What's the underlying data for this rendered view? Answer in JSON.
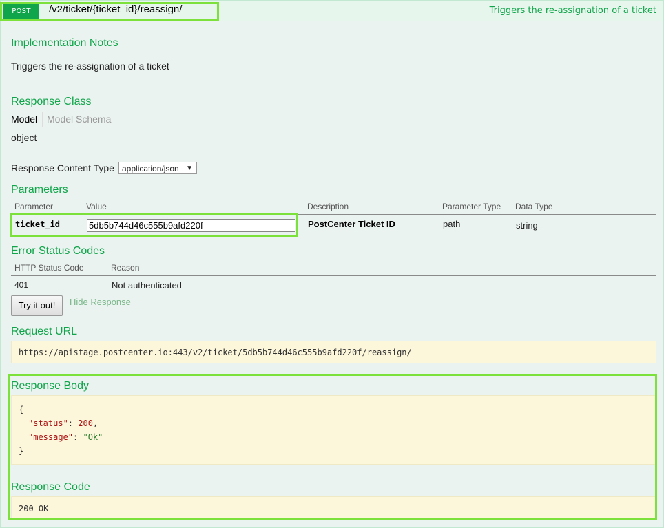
{
  "operation": {
    "method": "POST",
    "path": "/v2/ticket/{ticket_id}/reassign/",
    "summary": "Triggers the re-assignation of a ticket"
  },
  "implementation_notes": {
    "heading": "Implementation Notes",
    "text": "Triggers the re-assignation of a ticket"
  },
  "response_class": {
    "heading": "Response Class",
    "tab_model": "Model",
    "tab_schema": "Model Schema",
    "value": "object"
  },
  "response_content_type": {
    "label": "Response Content Type",
    "selected": "application/json"
  },
  "parameters": {
    "heading": "Parameters",
    "columns": [
      "Parameter",
      "Value",
      "Description",
      "Parameter Type",
      "Data Type"
    ],
    "rows": [
      {
        "name": "ticket_id",
        "value": "5db5b744d46c555b9afd220f",
        "description": "PostCenter Ticket ID",
        "param_type": "path",
        "data_type": "string"
      }
    ]
  },
  "error_status_codes": {
    "heading": "Error Status Codes",
    "columns": [
      "HTTP Status Code",
      "Reason"
    ],
    "rows": [
      {
        "code": "401",
        "reason": "Not authenticated"
      }
    ]
  },
  "actions": {
    "try_label": "Try it out!",
    "hide_label": "Hide Response"
  },
  "request_url": {
    "heading": "Request URL",
    "url": "https://apistage.postcenter.io:443/v2/ticket/5db5b744d46c555b9afd220f/reassign/"
  },
  "response_body": {
    "heading": "Response Body",
    "open_brace": "{",
    "close_brace": "}",
    "status_key": "\"status\"",
    "status_value": "200",
    "message_key": "\"message\"",
    "message_value": "\"Ok\""
  },
  "response_code": {
    "heading": "Response Code",
    "value": "200 OK"
  },
  "colors": {
    "accent": "#10a54a",
    "highlight": "#7de13c",
    "code_bg": "#fcf6db"
  }
}
